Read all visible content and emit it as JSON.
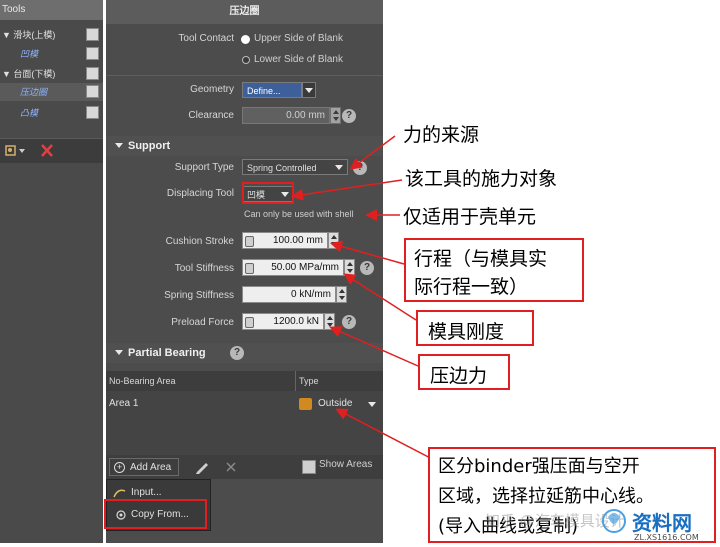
{
  "tools_panel": {
    "header": "Tools",
    "tree": [
      {
        "label": "▼ 滑块(上模)",
        "color": "#e0e0e0"
      },
      {
        "label": "凹模",
        "color": "#8fb4ff"
      },
      {
        "label": "▼ 台面(下模)",
        "color": "#e0e0e0"
      },
      {
        "label": "压边圈",
        "color": "#8fb4ff"
      },
      {
        "label": "凸模",
        "color": "#8fb4ff"
      }
    ]
  },
  "panel": {
    "title": "压边圈",
    "tool_contact": {
      "label": "Tool Contact",
      "options": [
        "Upper Side of Blank",
        "Lower Side of Blank"
      ],
      "selected": 0
    },
    "geometry": {
      "label": "Geometry",
      "value": "Define..."
    },
    "clearance": {
      "label": "Clearance",
      "value": "0.00 mm"
    },
    "support": {
      "heading": "Support",
      "support_type": {
        "label": "Support Type",
        "value": "Spring Controlled"
      },
      "displacing_tool": {
        "label": "Displacing Tool",
        "value": "凹模"
      },
      "note": "Can only be used with shell",
      "cushion_stroke": {
        "label": "Cushion Stroke",
        "value": "100.00 mm"
      },
      "tool_stiffness": {
        "label": "Tool Stiffness",
        "value": "50.00 MPa/mm"
      },
      "spring_stiffness": {
        "label": "Spring Stiffness",
        "value": "0 kN/mm"
      },
      "preload_force": {
        "label": "Preload Force",
        "value": "1200.0 kN"
      }
    },
    "partial_bearing": {
      "heading": "Partial Bearing",
      "columns": [
        "No-Bearing Area",
        "Type"
      ],
      "rows": [
        {
          "area": "Area 1",
          "type": "Outside"
        }
      ],
      "add_area": "Add Area",
      "show_areas": "Show Areas"
    }
  },
  "menu": {
    "items": [
      "Input...",
      "Copy From..."
    ]
  },
  "annotations": {
    "force_source": "力的来源",
    "apply_target": "该工具的施力对象",
    "shell_only": "仅适用于壳单元",
    "stroke": [
      "行程（与模具实",
      "际行程一致）"
    ],
    "stiffness": "模具刚度",
    "binder_force": "压边力",
    "binder_area": [
      "区分binder强压面与空开",
      "区域，选择拉延筋中心线。",
      "(导入曲线或复制)"
    ]
  },
  "watermark": {
    "zhihu": "知乎 @汽车模具设计",
    "brand": "资料网",
    "url": "ZL.XS1616.COM"
  },
  "colors": {
    "annotation_red": "#e02020",
    "arrow_red": "#e02020"
  }
}
